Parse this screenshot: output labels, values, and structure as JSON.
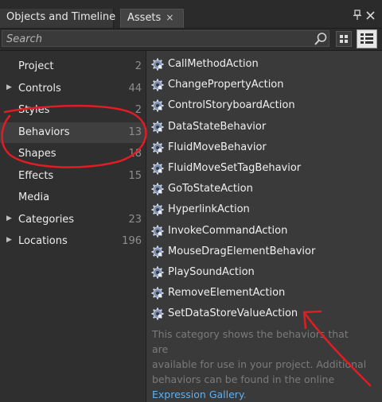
{
  "tabs": [
    {
      "label": "Objects and Timeline",
      "active": false
    },
    {
      "label": "Assets",
      "active": true
    }
  ],
  "tab_close_glyph": "×",
  "panel_controls": {
    "pin_icon": "pin-icon",
    "close_icon": "close-icon"
  },
  "search": {
    "placeholder": "Search",
    "value": ""
  },
  "view_buttons": {
    "grid": "grid-view-icon",
    "list": "list-view-icon",
    "selected": "list"
  },
  "categories": [
    {
      "label": "Project",
      "count": "2",
      "expandable": false,
      "selected": false
    },
    {
      "label": "Controls",
      "count": "44",
      "expandable": true,
      "selected": false
    },
    {
      "label": "Styles",
      "count": "2",
      "expandable": false,
      "selected": false
    },
    {
      "label": "Behaviors",
      "count": "13",
      "expandable": false,
      "selected": true
    },
    {
      "label": "Shapes",
      "count": "18",
      "expandable": false,
      "selected": false
    },
    {
      "label": "Effects",
      "count": "15",
      "expandable": false,
      "selected": false
    },
    {
      "label": "Media",
      "count": "",
      "expandable": false,
      "selected": false
    },
    {
      "label": "Categories",
      "count": "23",
      "expandable": true,
      "selected": false
    },
    {
      "label": "Locations",
      "count": "196",
      "expandable": true,
      "selected": false
    }
  ],
  "assets": [
    {
      "label": "CallMethodAction",
      "icon": "behavior-gear-icon"
    },
    {
      "label": "ChangePropertyAction",
      "icon": "behavior-gear-icon"
    },
    {
      "label": "ControlStoryboardAction",
      "icon": "behavior-gear-icon"
    },
    {
      "label": "DataStateBehavior",
      "icon": "behavior-gear-icon"
    },
    {
      "label": "FluidMoveBehavior",
      "icon": "behavior-gear-icon"
    },
    {
      "label": "FluidMoveSetTagBehavior",
      "icon": "behavior-gear-icon"
    },
    {
      "label": "GoToStateAction",
      "icon": "behavior-gear-icon"
    },
    {
      "label": "HyperlinkAction",
      "icon": "behavior-gear-icon"
    },
    {
      "label": "InvokeCommandAction",
      "icon": "behavior-gear-icon"
    },
    {
      "label": "MouseDragElementBehavior",
      "icon": "behavior-gear-icon"
    },
    {
      "label": "PlaySoundAction",
      "icon": "behavior-gear-icon"
    },
    {
      "label": "RemoveElementAction",
      "icon": "behavior-gear-icon"
    },
    {
      "label": "SetDataStoreValueAction",
      "icon": "behavior-gear-icon"
    }
  ],
  "description": {
    "lines": [
      "This category shows the behaviors that are",
      "available for use in your project. Additional",
      "behaviors can be found in the online"
    ],
    "link_text": "Expression Gallery",
    "suffix": "."
  },
  "annotations": {
    "color": "#e01c24",
    "ellipse_target": "Behaviors",
    "arrow_target": "SetDataStoreValueAction"
  },
  "colors": {
    "link": "#5fb0f0",
    "selected_row": "#3f3f3f",
    "panel_bg": "#3a3a3a"
  }
}
